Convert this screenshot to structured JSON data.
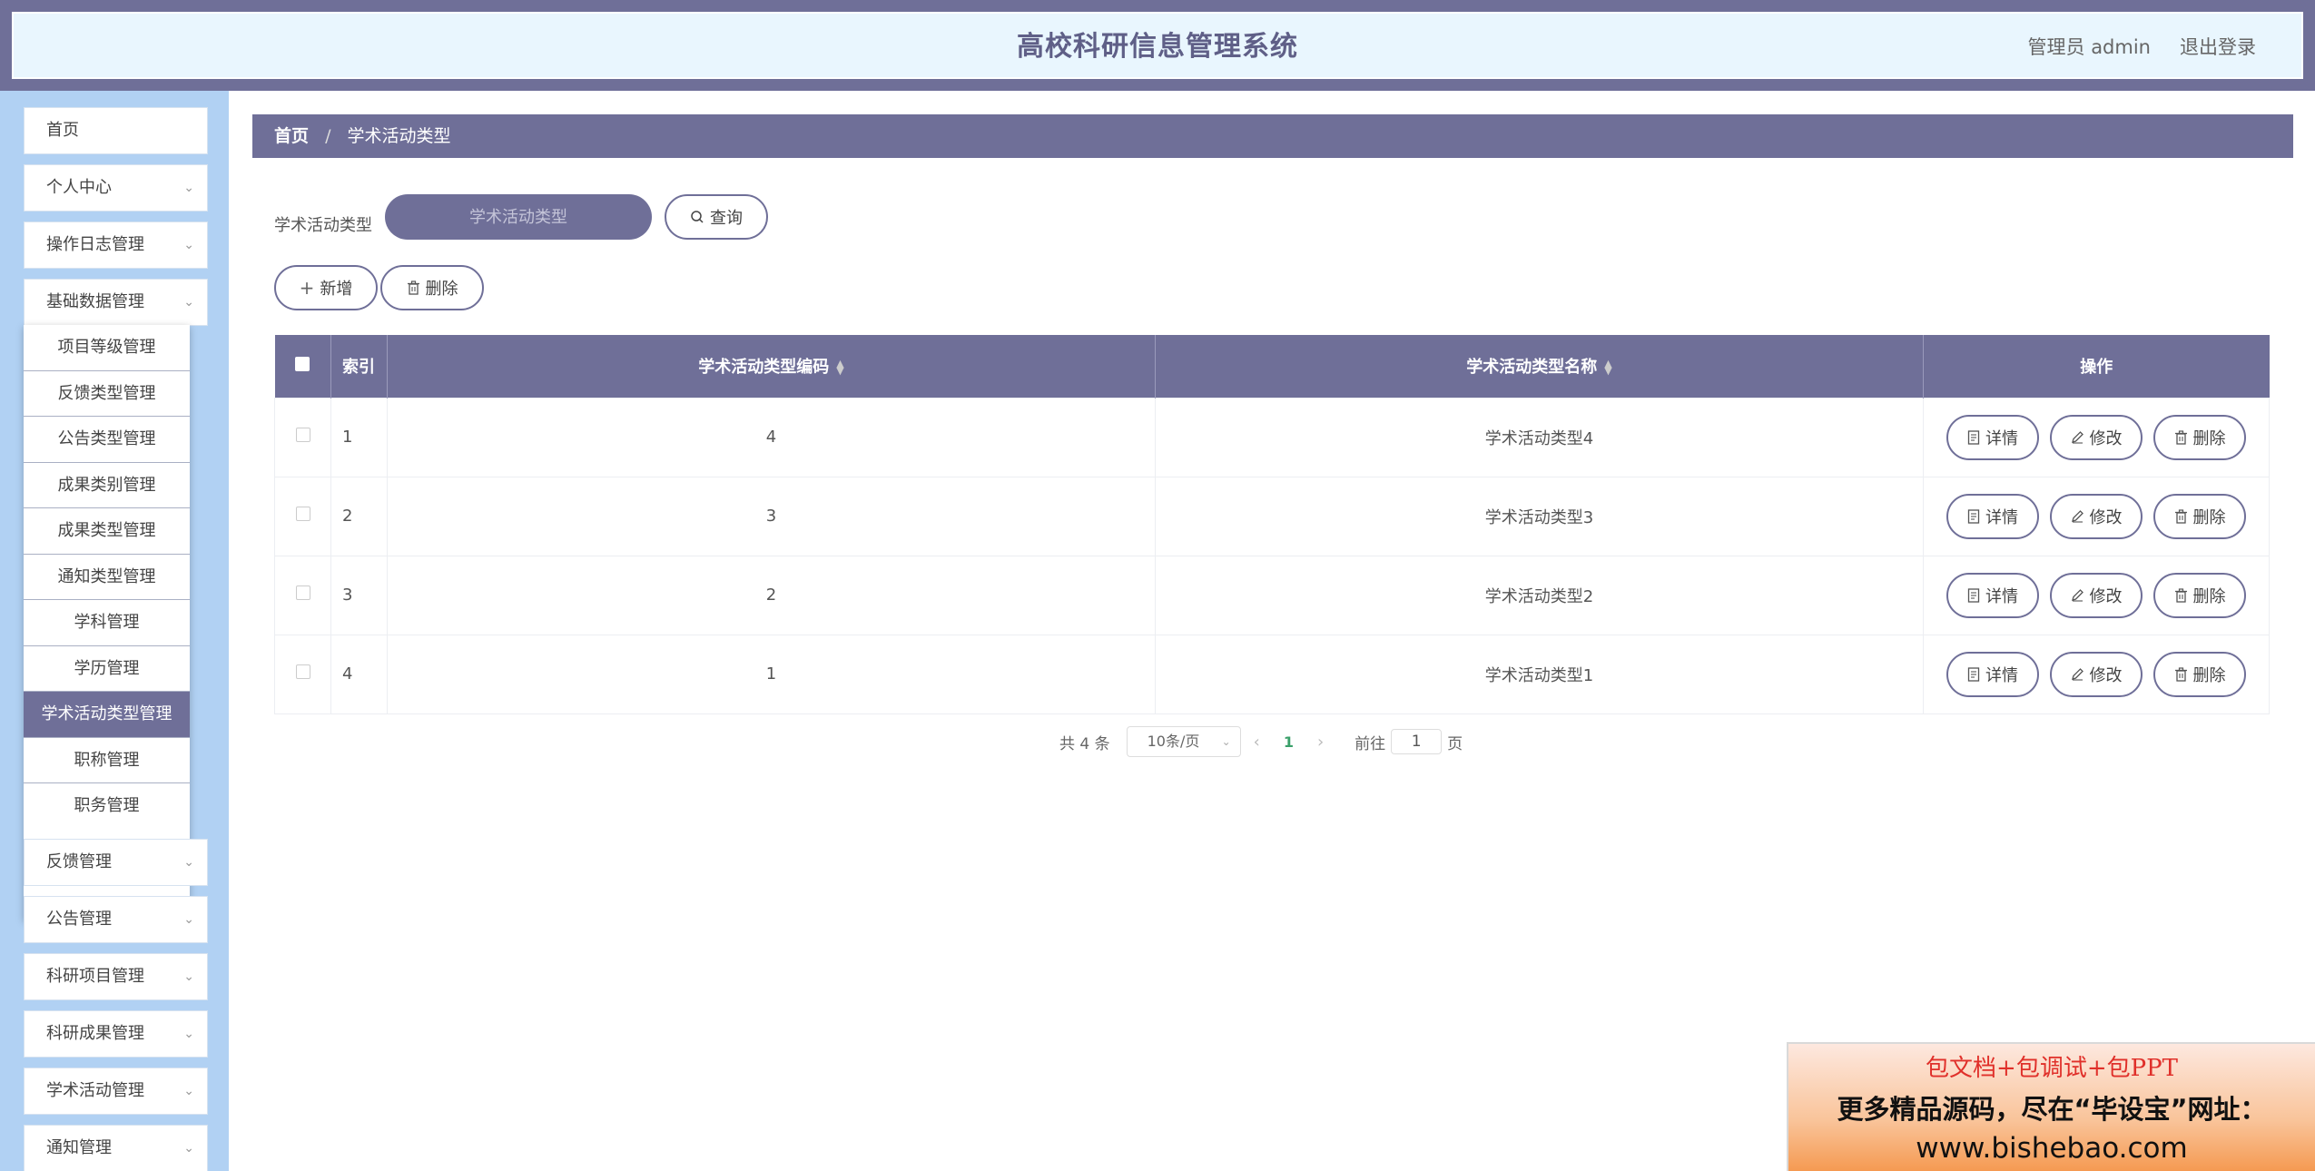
{
  "header": {
    "title": "高校科研信息管理系统",
    "user": "管理员 admin",
    "logout": "退出登录"
  },
  "sidebar": {
    "items": [
      {
        "label": "首页",
        "has_arrow": false
      },
      {
        "label": "个人中心",
        "has_arrow": true
      },
      {
        "label": "操作日志管理",
        "has_arrow": true
      },
      {
        "label": "基础数据管理",
        "has_arrow": true
      }
    ],
    "submenu": [
      "项目等级管理",
      "反馈类型管理",
      "公告类型管理",
      "成果类别管理",
      "成果类型管理",
      "通知类型管理",
      "学科管理",
      "学历管理",
      "学术活动类型管理",
      "职称管理",
      "职务管理"
    ],
    "submenu_active": "学术活动类型管理",
    "items_after": [
      {
        "label": "反馈管理"
      },
      {
        "label": "公告管理"
      },
      {
        "label": "科研项目管理"
      },
      {
        "label": "科研成果管理"
      },
      {
        "label": "学术活动管理"
      },
      {
        "label": "通知管理"
      }
    ]
  },
  "breadcrumb": {
    "home": "首页",
    "separator": "/",
    "current": "学术活动类型"
  },
  "search": {
    "label": "学术活动类型",
    "placeholder": "学术活动类型",
    "query_label": "查询"
  },
  "toolbar": {
    "add_label": "新增",
    "delete_label": "删除"
  },
  "table": {
    "headers": {
      "index": "索引",
      "code": "学术活动类型编码",
      "name": "学术活动类型名称",
      "ops": "操作"
    },
    "rows": [
      {
        "index": "1",
        "code": "4",
        "name": "学术活动类型4"
      },
      {
        "index": "2",
        "code": "3",
        "name": "学术活动类型3"
      },
      {
        "index": "3",
        "code": "2",
        "name": "学术活动类型2"
      },
      {
        "index": "4",
        "code": "1",
        "name": "学术活动类型1"
      }
    ],
    "row_ops": {
      "detail": "详情",
      "edit": "修改",
      "delete": "删除"
    }
  },
  "pagination": {
    "total": "共 4 条",
    "page_size": "10条/页",
    "current_page": "1",
    "goto_prefix": "前往",
    "goto_value": "1",
    "goto_suffix": "页"
  },
  "ad": {
    "line1": "包文档+包调试+包PPT",
    "line2": "更多精品源码，尽在“毕设宝”网址：",
    "line3": "www.bishebao.com"
  },
  "colors": {
    "primary": "#6f6f98",
    "sidebar_bg": "#b1d1f3",
    "header_bg": "#e9f6fe",
    "page_active": "#3aa06a"
  }
}
